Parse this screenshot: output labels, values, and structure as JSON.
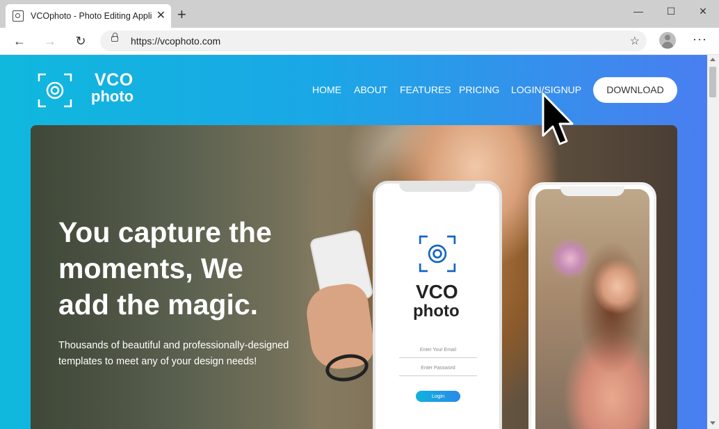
{
  "browser": {
    "tab_title": "VCOphoto - Photo Editing Applic",
    "url": "https://vcophoto.com",
    "new_tab": "+",
    "tab_close": "✕",
    "win_min": "—",
    "win_max": "☐",
    "win_close": "✕",
    "back": "←",
    "forward": "→",
    "reload": "↻",
    "menu": "···"
  },
  "site": {
    "brand_line1": "VCO",
    "brand_line2": "photo",
    "nav": [
      "HOME",
      "ABOUT",
      "FEATURES",
      "PRICING",
      "LOGIN/SIGNUP"
    ],
    "download_label": "DOWNLOAD"
  },
  "hero": {
    "headline_lines": [
      "You capture the",
      "moments, We",
      "add the magic."
    ],
    "subtext_lines": [
      "Thousands of beautiful and professionally-designed",
      "templates to meet any of your design needs!"
    ]
  },
  "mockup": {
    "brand_line1": "VCO",
    "brand_line2": "photo",
    "email_placeholder": "Enter Your Email",
    "password_placeholder": "Enter Password",
    "login_label": "Login"
  },
  "colors": {
    "gradient_start": "#10b8de",
    "gradient_end": "#4a7ef0",
    "button_bg": "#ffffff"
  }
}
